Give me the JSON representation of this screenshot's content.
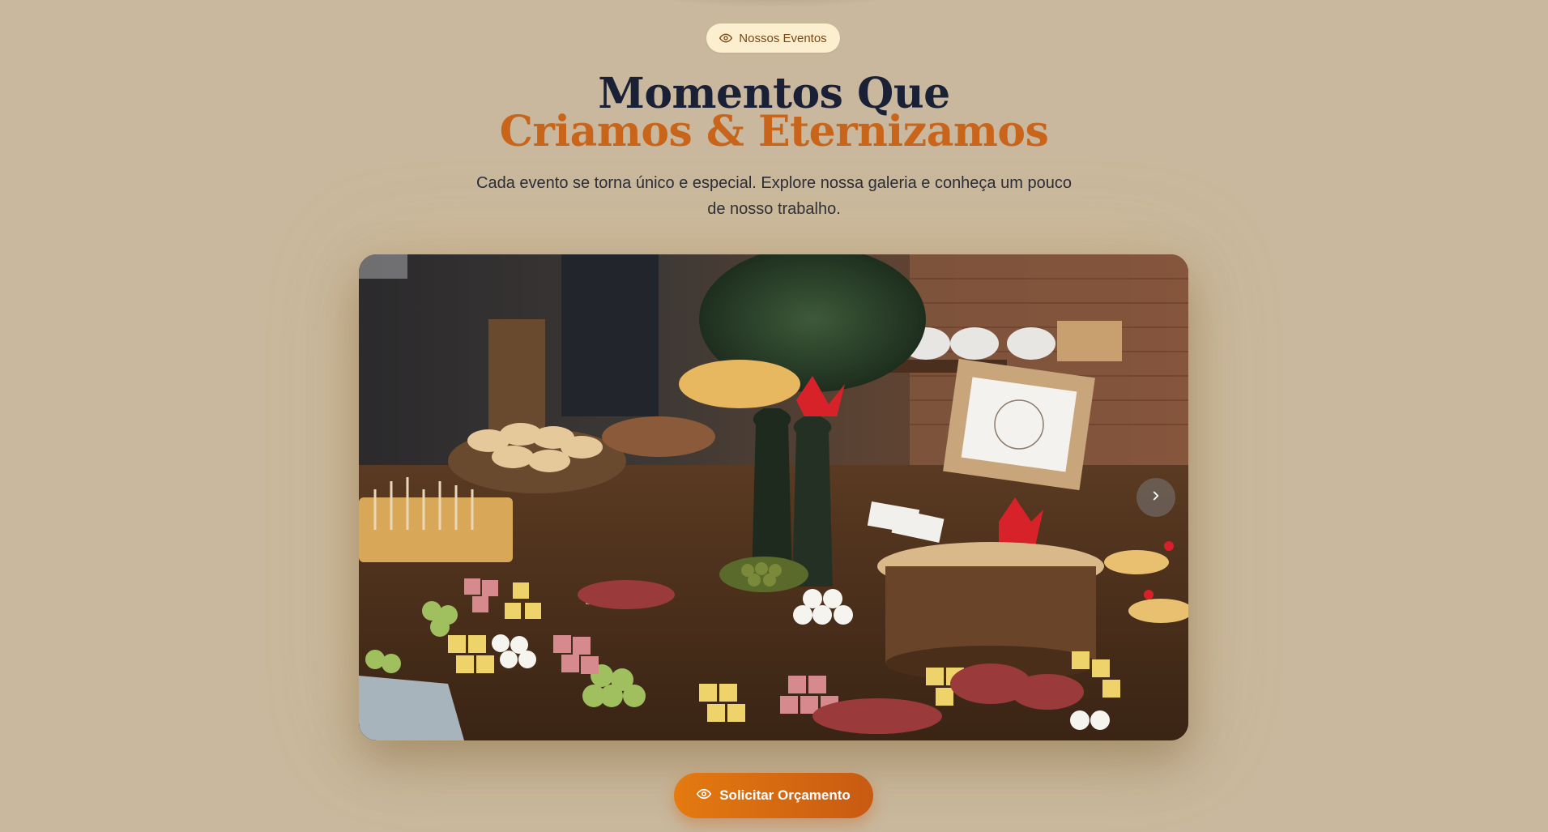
{
  "badge": {
    "label": "Nossos Eventos",
    "icon": "eye-icon"
  },
  "hero": {
    "title_line_1": "Momentos Que",
    "title_line_2": "Criamos & Eternizamos",
    "subtitle": "Cada evento se torna único e especial. Explore nossa galeria e conheça um pouco de nosso trabalho."
  },
  "gallery": {
    "next_icon": "chevron-right-icon"
  },
  "cta": {
    "label": "Solicitar Orçamento",
    "icon": "eye-icon"
  },
  "colors": {
    "background": "#c9b89d",
    "badge_bg": "#fbefcf",
    "title_dark": "#1a2036",
    "title_accent": "#c8651a",
    "cta_start": "#e47a10",
    "cta_end": "#c85a12"
  }
}
